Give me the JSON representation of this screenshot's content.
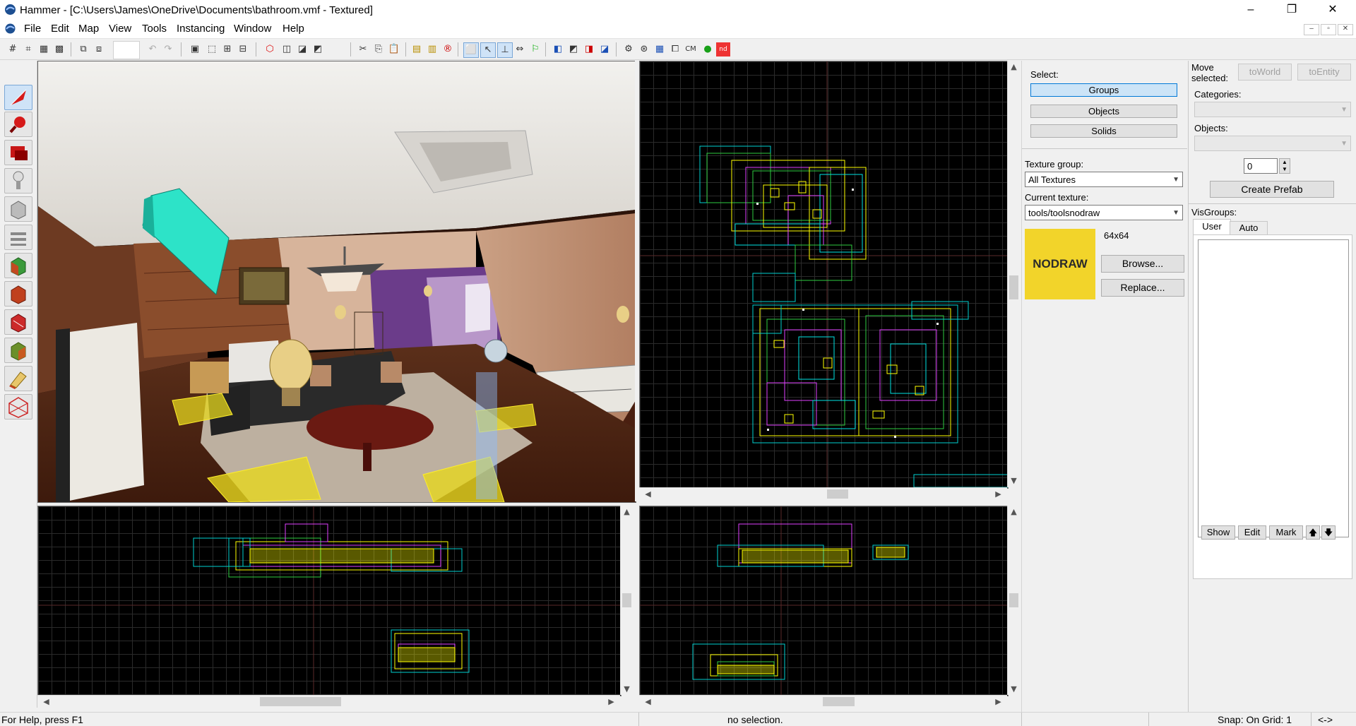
{
  "window": {
    "title": "Hammer - [C:\\Users\\James\\OneDrive\\Documents\\bathroom.vmf - Textured]",
    "controls": {
      "minimize": "–",
      "maximize": "❐",
      "close": "✕"
    }
  },
  "menu": {
    "items": [
      "File",
      "Edit",
      "Map",
      "View",
      "Tools",
      "Instancing",
      "Window",
      "Help"
    ],
    "mdi": {
      "minimize": "–",
      "restore": "▫",
      "close": "✕"
    }
  },
  "toolbar": {
    "cm_label": "CM"
  },
  "select_panel": {
    "label": "Select:",
    "buttons": [
      "Groups",
      "Objects",
      "Solids"
    ],
    "selected": "Groups"
  },
  "texture_panel": {
    "group_label": "Texture group:",
    "group_value": "All Textures",
    "current_label": "Current texture:",
    "current_value": "tools/toolsnodraw",
    "preview_text": "NODRAW",
    "preview_color": "#f2d42a",
    "size": "64x64",
    "browse_label": "Browse...",
    "replace_label": "Replace..."
  },
  "move_panel": {
    "label": "Move selected:",
    "to_world": "toWorld",
    "to_entity": "toEntity",
    "categories_label": "Categories:",
    "objects_label": "Objects:",
    "spin_value": "0",
    "create_prefab": "Create Prefab"
  },
  "visgroups": {
    "label": "VisGroups:",
    "tabs": [
      "User",
      "Auto"
    ],
    "active_tab": "User",
    "buttons": {
      "show": "Show",
      "edit": "Edit",
      "mark": "Mark",
      "up": "🡅",
      "down": "🡇"
    }
  },
  "statusbar": {
    "help": "For Help, press F1",
    "selection": "no selection.",
    "snap": "Snap: On Grid: 1",
    "arrows": "<->"
  },
  "colors": {
    "accent": "#0078d7",
    "grid_major": "#4a4a4a",
    "grid_minor": "#2b2b2b",
    "brush_yellow": "#ffff00",
    "brush_green": "#2ecc40",
    "brush_magenta": "#e040ff",
    "brush_cyan": "#00e5e5"
  }
}
